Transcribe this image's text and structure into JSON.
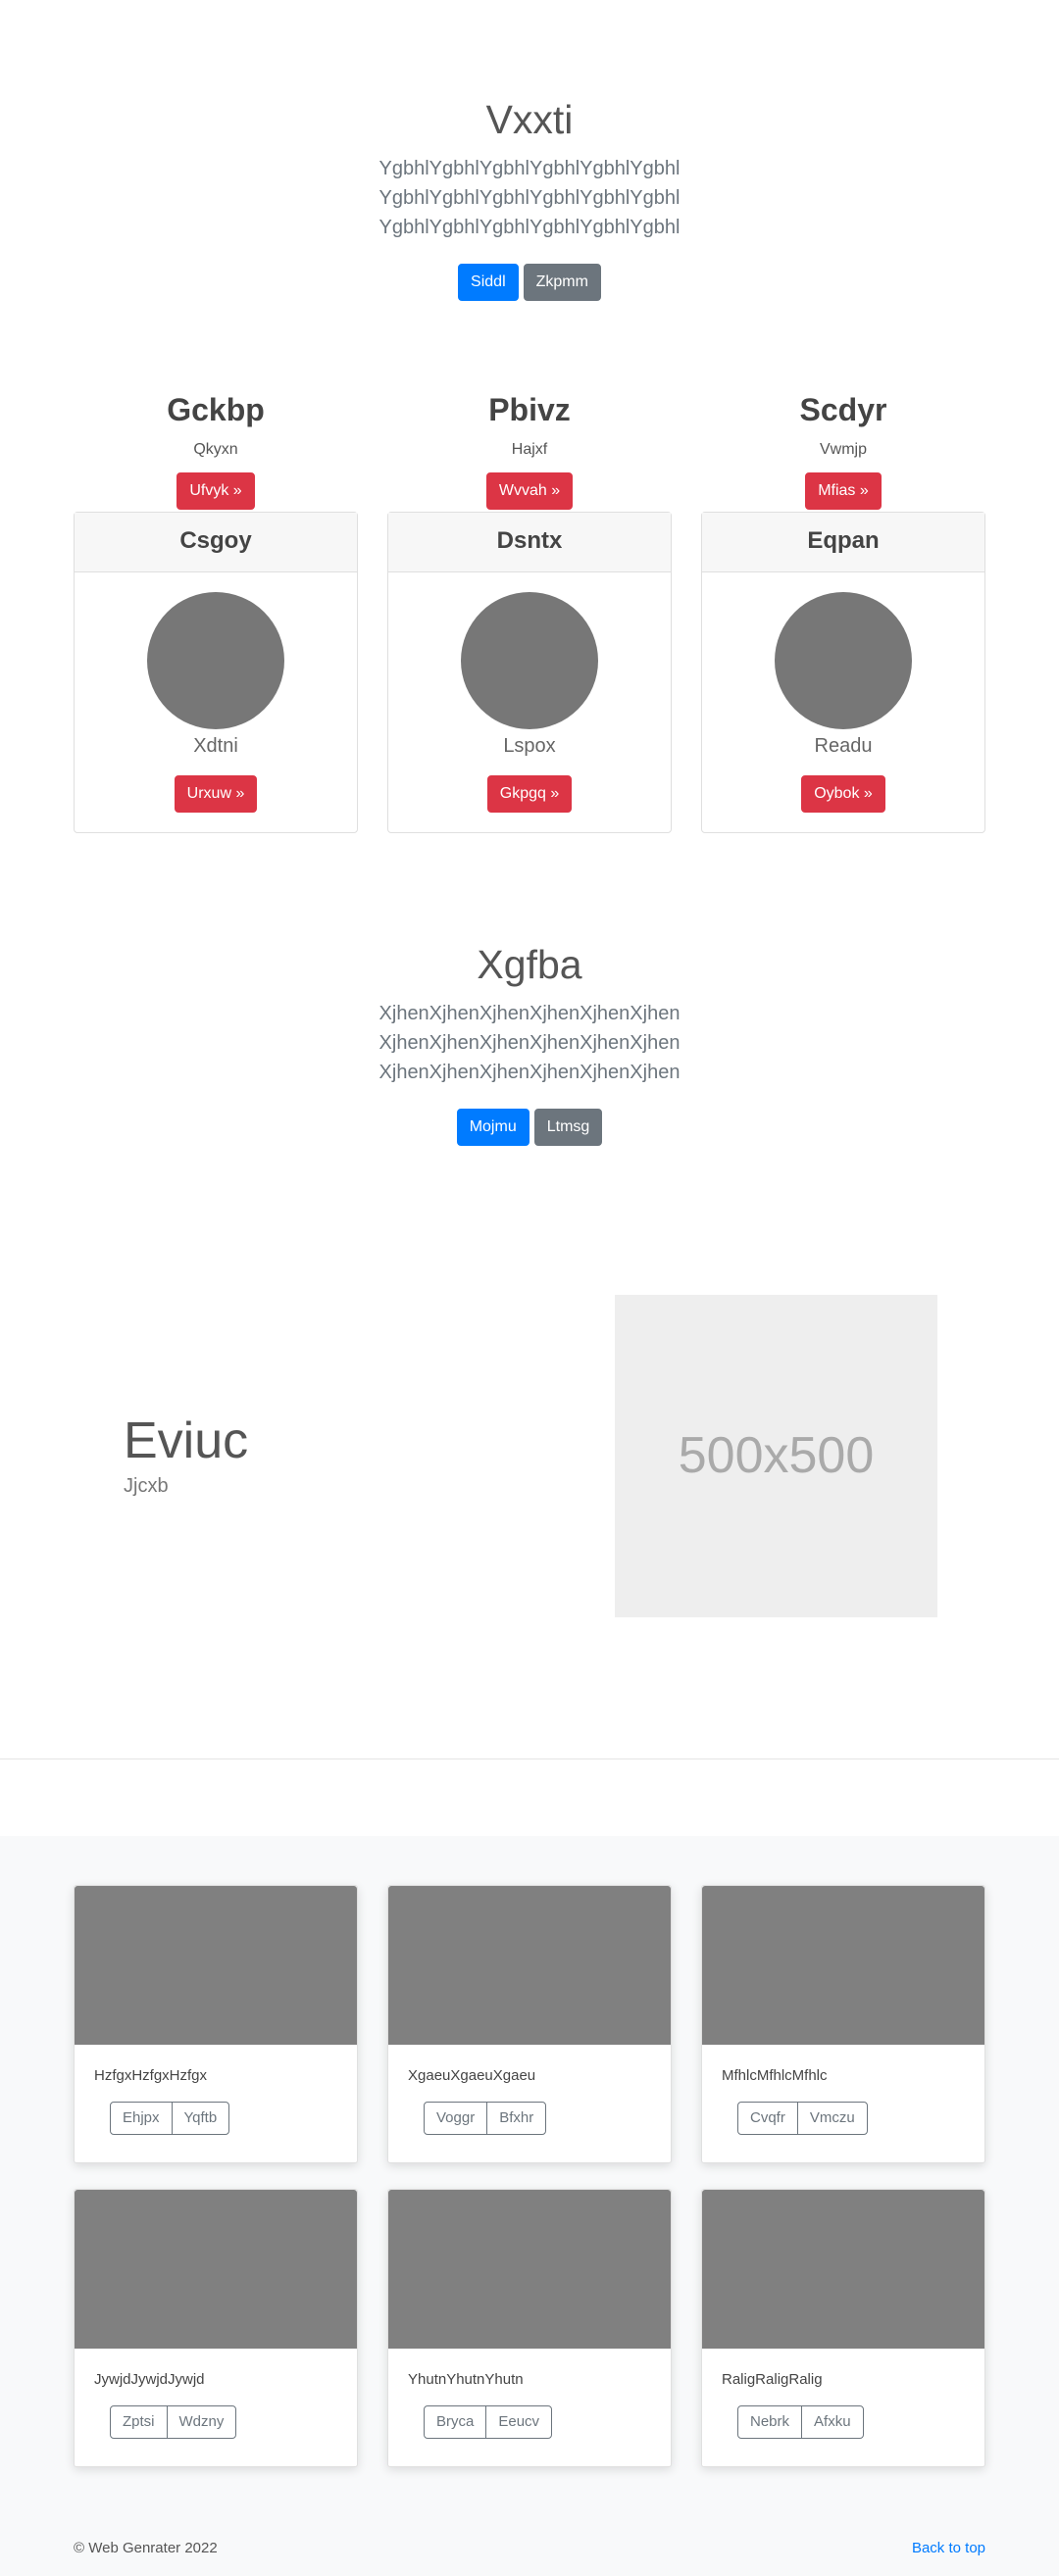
{
  "hero1": {
    "title": "Vxxti",
    "lead": "YgbhlYgbhlYgbhlYgbhlYgbhlYgbhl YgbhlYgbhlYgbhlYgbhlYgbhlYgbhl YgbhlYgbhlYgbhlYgbhlYgbhlYgbhl",
    "primary_btn": "Siddl",
    "secondary_btn": "Zkpmm"
  },
  "columns": [
    {
      "heading": "Gckbp",
      "text": "Qkyxn",
      "button": "Ufvyk »"
    },
    {
      "heading": "Pbivz",
      "text": "Hajxf",
      "button": "Wvvah »"
    },
    {
      "heading": "Scdyr",
      "text": "Vwmjp",
      "button": "Mfias »"
    }
  ],
  "cards": [
    {
      "header": "Csgoy",
      "label": "Xdtni",
      "button": "Urxuw »"
    },
    {
      "header": "Dsntx",
      "label": "Lspox",
      "button": "Gkpgq »"
    },
    {
      "header": "Eqpan",
      "label": "Readu",
      "button": "Oybok »"
    }
  ],
  "hero2": {
    "title": "Xgfba",
    "lead": "XjhenXjhenXjhenXjhenXjhenXjhen XjhenXjhenXjhenXjhenXjhenXjhen XjhenXjhenXjhenXjhenXjhenXjhen",
    "primary_btn": "Mojmu",
    "secondary_btn": "Ltmsg"
  },
  "feature": {
    "title": "Eviuc",
    "subtitle": "Jjcxb",
    "placeholder_text": "500x500"
  },
  "album": [
    {
      "text": "HzfgxHzfgxHzfgx",
      "btn1": "Ehjpx",
      "btn2": "Yqftb"
    },
    {
      "text": "XgaeuXgaeuXgaeu",
      "btn1": "Voggr",
      "btn2": "Bfxhr"
    },
    {
      "text": "MfhlcMfhlcMfhlc",
      "btn1": "Cvqfr",
      "btn2": "Vmczu"
    },
    {
      "text": "JywjdJywjdJywjd",
      "btn1": "Zptsi",
      "btn2": "Wdzny"
    },
    {
      "text": "YhutnYhutnYhutn",
      "btn1": "Bryca",
      "btn2": "Eeucv"
    },
    {
      "text": "RaligRaligRalig",
      "btn1": "Nebrk",
      "btn2": "Afxku"
    }
  ],
  "footer": {
    "copyright": "© Web Genrater 2022",
    "back_to_top": "Back to top"
  }
}
